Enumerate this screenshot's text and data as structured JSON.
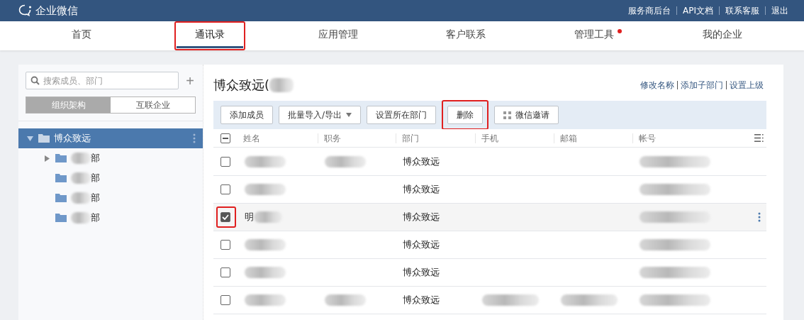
{
  "header": {
    "logo": "企业微信",
    "links": [
      "服务商后台",
      "API文档",
      "联系客服",
      "退出"
    ]
  },
  "nav": [
    {
      "label": "首页",
      "selected": false
    },
    {
      "label": "通讯录",
      "selected": true,
      "highlighted": true
    },
    {
      "label": "应用管理",
      "selected": false
    },
    {
      "label": "客户联系",
      "selected": false
    },
    {
      "label": "管理工具",
      "selected": false,
      "dot": true
    },
    {
      "label": "我的企业",
      "selected": false
    }
  ],
  "sidebar": {
    "search": {
      "placeholder": "搜索成员、部门"
    },
    "add": "+",
    "tabs": [
      {
        "label": "组织架构",
        "selected": true
      },
      {
        "label": "互联企业",
        "selected": false
      }
    ],
    "tree": [
      {
        "label": "博众致远",
        "selected": true,
        "expanded": true,
        "children": [
          {
            "label": "部",
            "selected": false,
            "expanded": false,
            "masked": true
          },
          {
            "label": "部",
            "selected": false,
            "masked": true
          },
          {
            "label": "部",
            "selected": false,
            "masked": true
          },
          {
            "label": "部",
            "selected": false,
            "masked": true
          }
        ]
      }
    ]
  },
  "main": {
    "title": "博众致远(",
    "title_masked": true,
    "actions": [
      "修改名称",
      "添加子部门",
      "设置上级"
    ],
    "toolbar": [
      {
        "label": "添加成员",
        "kind": "plain"
      },
      {
        "label": "批量导入/导出",
        "kind": "dropdown"
      },
      {
        "label": "设置所在部门",
        "kind": "plain"
      },
      {
        "label": "删除",
        "kind": "plain",
        "highlighted": true
      },
      {
        "label": "微信邀请",
        "kind": "qr"
      }
    ],
    "table": {
      "select_all_indeterminate": true,
      "columns": [
        "姓名",
        "职务",
        "部门",
        "手机",
        "邮箱",
        "帐号"
      ],
      "rows": [
        {
          "checked": false,
          "selected": false,
          "cells": [
            {
              "masked": true
            },
            {
              "masked": true
            },
            {
              "text": "博众致远"
            },
            null,
            null,
            {
              "masked": true
            }
          ]
        },
        {
          "checked": false,
          "selected": false,
          "cells": [
            {
              "masked": true
            },
            null,
            {
              "text": "博众致远"
            },
            null,
            null,
            {
              "masked": true
            }
          ]
        },
        {
          "checked": true,
          "selected": true,
          "highlighted": true,
          "cells": [
            {
              "text": "明",
              "masked": true
            },
            null,
            {
              "text": "博众致远"
            },
            null,
            null,
            {
              "masked": true
            }
          ]
        },
        {
          "checked": false,
          "selected": false,
          "cells": [
            {
              "masked": true
            },
            null,
            {
              "text": "博众致远"
            },
            null,
            null,
            {
              "masked": true
            }
          ]
        },
        {
          "checked": false,
          "selected": false,
          "cells": [
            {
              "masked": true
            },
            null,
            {
              "text": "博众致远"
            },
            null,
            null,
            {
              "masked": true
            }
          ]
        },
        {
          "checked": false,
          "selected": false,
          "cells": [
            {
              "masked": true
            },
            {
              "masked": true
            },
            {
              "text": "博众致远"
            },
            {
              "masked": true
            },
            {
              "masked": true
            },
            {
              "masked": true
            }
          ]
        }
      ]
    }
  }
}
